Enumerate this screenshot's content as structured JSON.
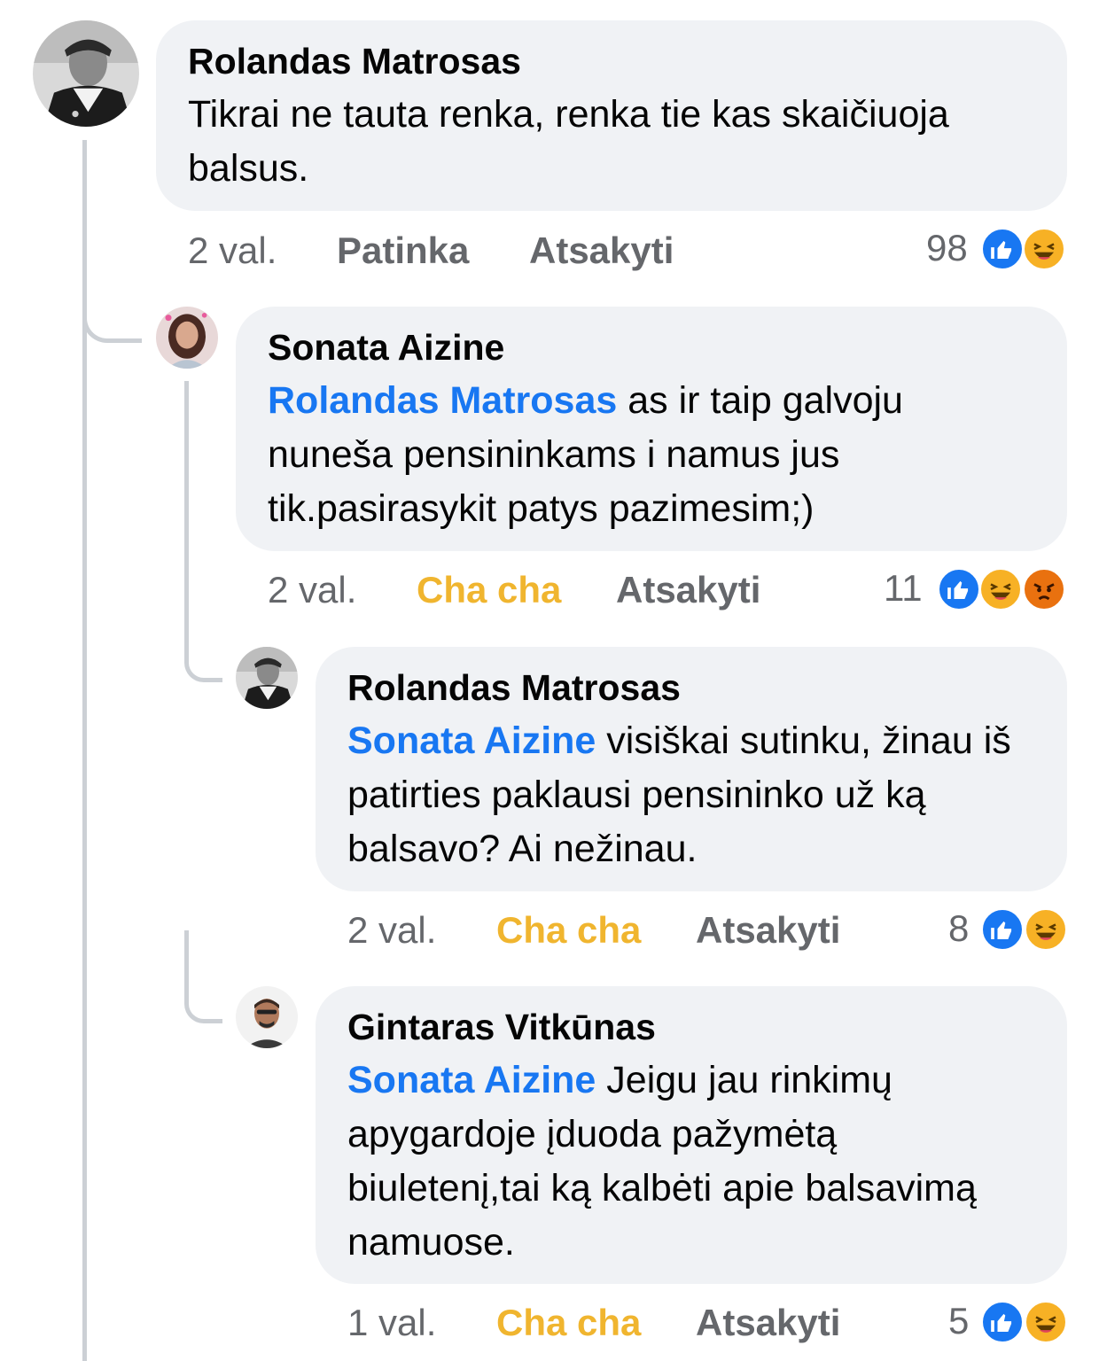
{
  "comments": [
    {
      "author": "Rolandas Matrosas",
      "mention": "",
      "text": "Tikrai ne tauta renka, renka tie kas skaičiuoja balsus.",
      "time": "2 val.",
      "like_label": "Patinka",
      "reply_label": "Atsakyti",
      "reaction_count": "98",
      "reactions": [
        "like-icon",
        "haha-icon"
      ],
      "avatar": "sailor-portrait"
    },
    {
      "author": "Sonata Aizine",
      "mention": "Rolandas Matrosas",
      "text": "as ir taip galvoju nuneša pensininkams i namus jus tik.pasirasykit patys pazimesim;)",
      "time": "2 val.",
      "like_label": "Cha cha",
      "reply_label": "Atsakyti",
      "reaction_count": "11",
      "reactions": [
        "like-icon",
        "haha-icon",
        "angry-icon"
      ],
      "avatar": "woman-portrait"
    },
    {
      "author": "Rolandas Matrosas",
      "mention": "Sonata Aizine",
      "text": "visiškai sutinku, žinau iš patirties paklausi pensininko už ką balsavo? Ai nežinau.",
      "time": "2 val.",
      "like_label": "Cha cha",
      "reply_label": "Atsakyti",
      "reaction_count": "8",
      "reactions": [
        "like-icon",
        "haha-icon"
      ],
      "avatar": "sailor-portrait"
    },
    {
      "author": "Gintaras Vitkūnas",
      "mention": "Sonata Aizine",
      "text": "Jeigu jau rinkimų apygardoje įduoda pažymėtą biuletenį,tai ką kalbėti apie balsavimą namuose.",
      "time": "1 val.",
      "like_label": "Cha cha",
      "reply_label": "Atsakyti",
      "reaction_count": "5",
      "reactions": [
        "like-icon",
        "haha-icon"
      ],
      "avatar": "man-portrait"
    }
  ],
  "colors": {
    "mention": "#1877f2",
    "haha_action": "#f0b52f",
    "bubble": "#f0f2f5",
    "meta": "#65676b",
    "thread_line": "#ccd0d5"
  }
}
